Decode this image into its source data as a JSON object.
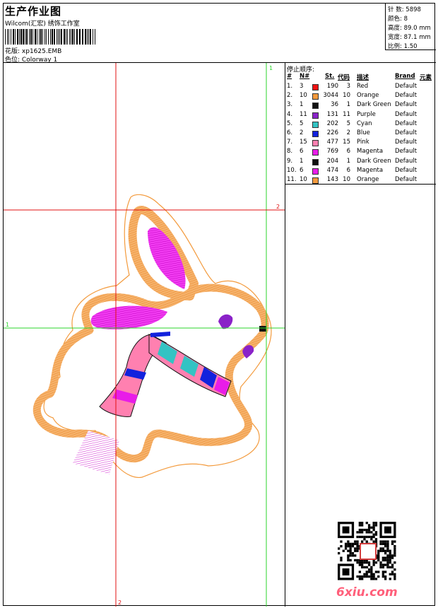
{
  "header": {
    "title": "生产作业图",
    "company": "Wilcom(汇宏) 绣饰工作室",
    "pattern_label": "花版:",
    "pattern_value": "xp1625.EMB",
    "colorway_label": "色位:",
    "colorway_value": "Colorway 1"
  },
  "stats": [
    {
      "label": "针 数:",
      "value": "5898"
    },
    {
      "label": "颜色:",
      "value": "8"
    },
    {
      "label": "高度:",
      "value": "89.0 mm"
    },
    {
      "label": "宽度:",
      "value": "87.1 mm"
    },
    {
      "label": "比例:",
      "value": "1.50"
    }
  ],
  "color_table": {
    "title": "停止顺序:",
    "headers": [
      "#",
      "N#",
      "St.",
      "代码",
      "描述",
      "Brand",
      "元素"
    ],
    "rows": [
      {
        "idx": "1.",
        "n": "3",
        "hex": "#ee1111",
        "st": "190",
        "code": "3",
        "desc": "Red",
        "brand": "Default"
      },
      {
        "idx": "2.",
        "n": "10",
        "hex": "#f39a3c",
        "st": "3044",
        "code": "10",
        "desc": "Orange",
        "brand": "Default"
      },
      {
        "idx": "3.",
        "n": "1",
        "hex": "#111111",
        "st": "36",
        "code": "1",
        "desc": "Dark Green",
        "brand": "Default"
      },
      {
        "idx": "4.",
        "n": "11",
        "hex": "#8a22c8",
        "st": "131",
        "code": "11",
        "desc": "Purple",
        "brand": "Default"
      },
      {
        "idx": "5.",
        "n": "5",
        "hex": "#33c3c3",
        "st": "202",
        "code": "5",
        "desc": "Cyan",
        "brand": "Default"
      },
      {
        "idx": "6.",
        "n": "2",
        "hex": "#1122dd",
        "st": "226",
        "code": "2",
        "desc": "Blue",
        "brand": "Default"
      },
      {
        "idx": "7.",
        "n": "15",
        "hex": "#ff80b0",
        "st": "477",
        "code": "15",
        "desc": "Pink",
        "brand": "Default"
      },
      {
        "idx": "8.",
        "n": "6",
        "hex": "#e81ce8",
        "st": "769",
        "code": "6",
        "desc": "Magenta",
        "brand": "Default"
      },
      {
        "idx": "9.",
        "n": "1",
        "hex": "#111111",
        "st": "204",
        "code": "1",
        "desc": "Dark Green",
        "brand": "Default"
      },
      {
        "idx": "10.",
        "n": "6",
        "hex": "#e81ce8",
        "st": "474",
        "code": "6",
        "desc": "Magenta",
        "brand": "Default"
      },
      {
        "idx": "11.",
        "n": "10",
        "hex": "#f39a3c",
        "st": "143",
        "code": "10",
        "desc": "Orange",
        "brand": "Default"
      }
    ]
  },
  "guides": {
    "v1": "1",
    "h2": "2",
    "h1": "1",
    "v2": "2"
  },
  "watermark": "6xiu.com",
  "colors": {
    "vertical_red": "#e01010",
    "vertical_green": "#2bd52b",
    "orange": "#f39a3c",
    "magenta": "#e81ce8",
    "pink": "#ff80b0",
    "cyan": "#33c3c3",
    "blue": "#1122dd",
    "purple": "#8a22c8"
  }
}
